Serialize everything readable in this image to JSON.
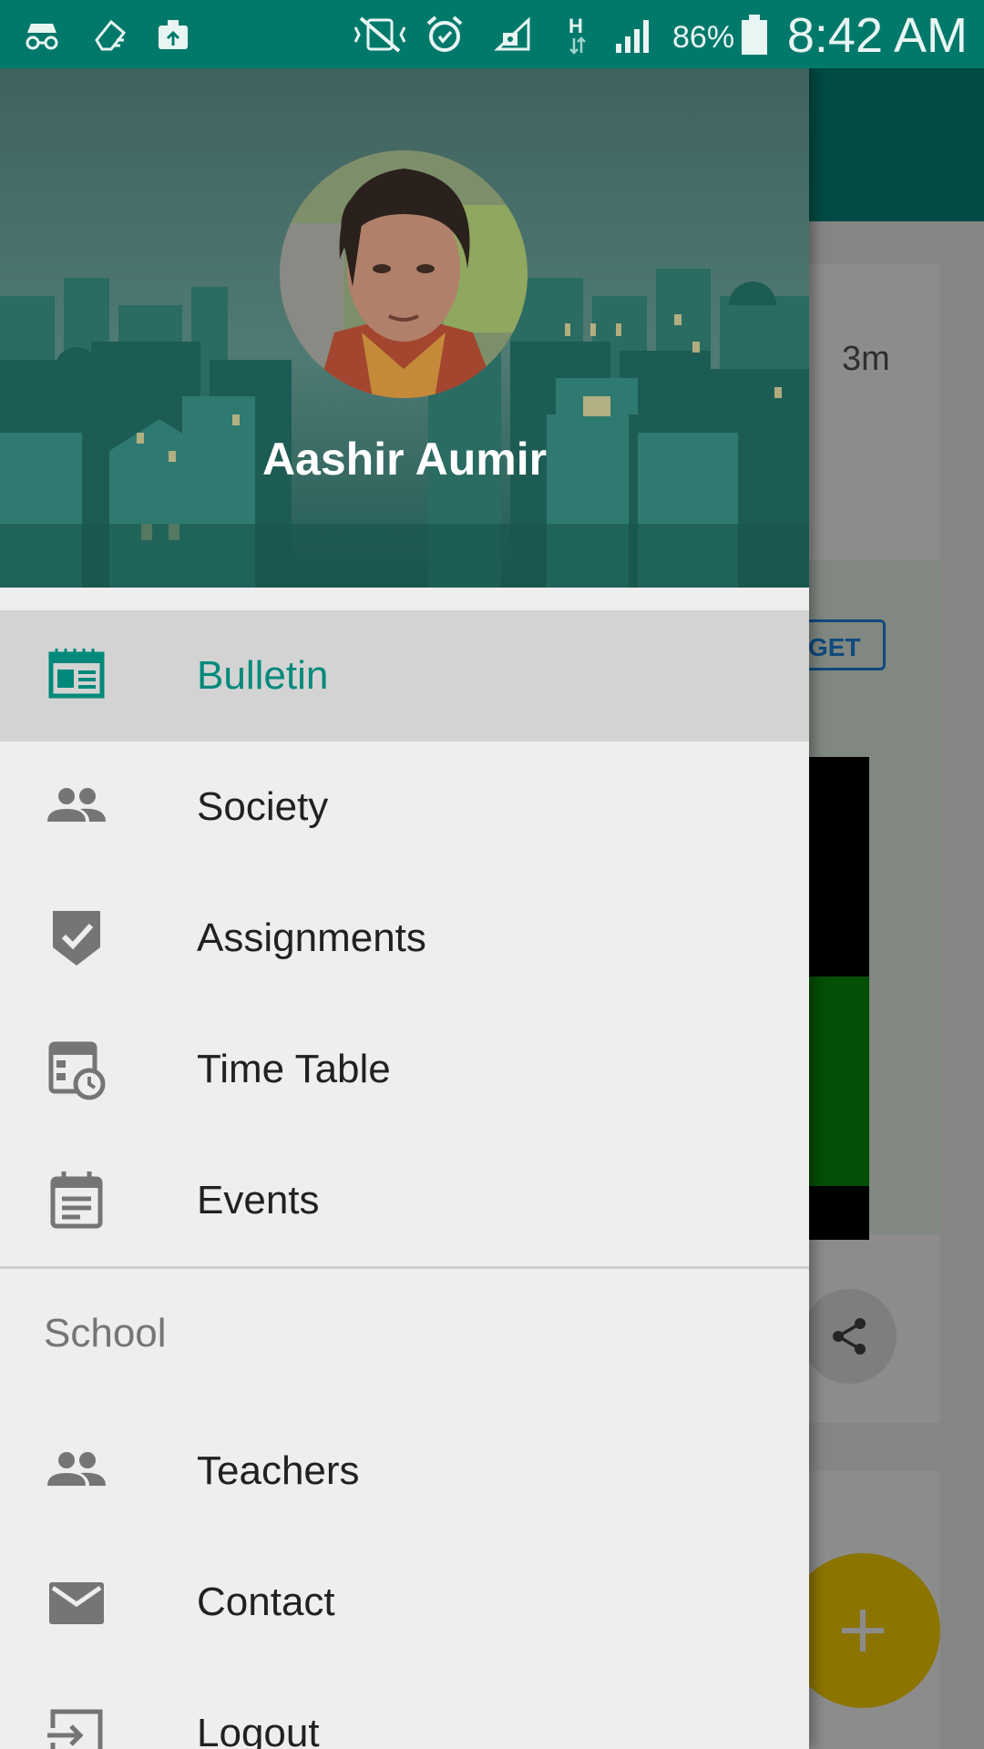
{
  "status_bar": {
    "battery_percent": "86%",
    "clock": "8:42 AM",
    "icons": [
      "incognito-icon",
      "eraser-icon",
      "upload-icon",
      "vibrate-off-icon",
      "alarm-icon",
      "signal-lock-icon",
      "h-network-icon",
      "cell-signal-icon",
      "battery-icon"
    ]
  },
  "background": {
    "card_timestamp": "3m",
    "forget_label": "GET"
  },
  "drawer": {
    "user_name": "Aashir Aumir",
    "menu": [
      {
        "label": "Bulletin",
        "icon": "bulletin-icon",
        "active": true
      },
      {
        "label": "Society",
        "icon": "people-icon"
      },
      {
        "label": "Assignments",
        "icon": "assignment-check-icon"
      },
      {
        "label": "Time Table",
        "icon": "timetable-icon"
      },
      {
        "label": "Events",
        "icon": "event-note-icon"
      }
    ],
    "section_school": "School",
    "school_menu": [
      {
        "label": "Teachers",
        "icon": "people-icon"
      },
      {
        "label": "Contact",
        "icon": "mail-icon"
      },
      {
        "label": "Logout",
        "icon": "logout-icon"
      }
    ]
  },
  "colors": {
    "status_bar": "#00796b",
    "accent": "#00897b",
    "fab": "#ffd400"
  }
}
